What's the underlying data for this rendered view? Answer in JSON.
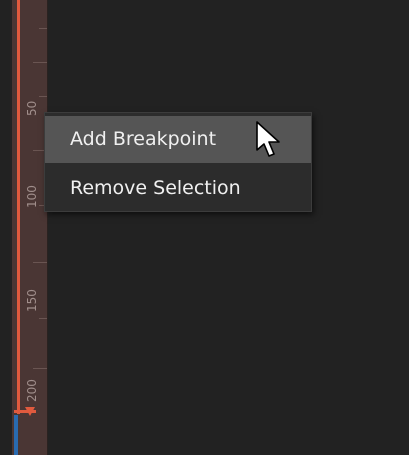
{
  "ruler": {
    "labels": [
      "50",
      "100",
      "150",
      "200"
    ]
  },
  "context_menu": {
    "items": [
      {
        "label": "Add Breakpoint",
        "highlighted": true
      },
      {
        "label": "Remove Selection",
        "highlighted": false
      }
    ]
  },
  "colors": {
    "background": "#222222",
    "ruler": "#4a3634",
    "range_marker": "#e05a3e",
    "playhead": "#2a6bb0",
    "menu_background": "#2c2c2c",
    "menu_highlight": "#555555",
    "menu_text": "#f0f0f0"
  },
  "icons": {
    "cursor": "arrow-pointer-icon",
    "range_handle": "triangle-down-icon"
  }
}
